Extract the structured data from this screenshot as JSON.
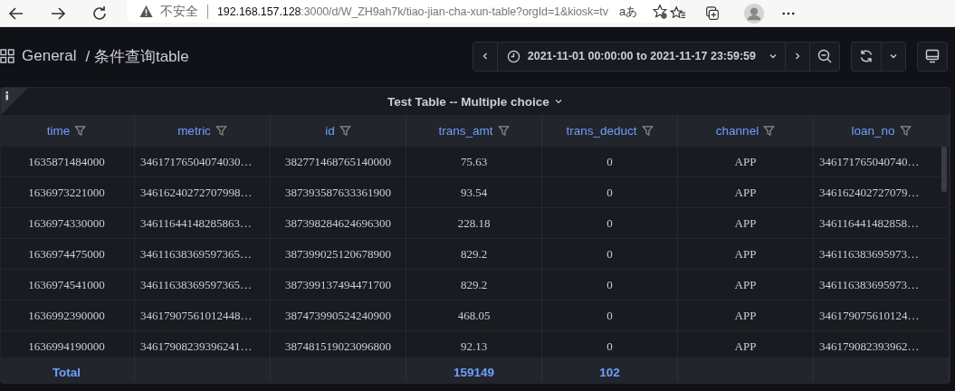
{
  "browser": {
    "security_label": "不安全",
    "url_host": "192.168.157.128",
    "url_rest": ":3000/d/W_ZH9ah7k/tiao-jian-cha-xun-table?orgId=1&kiosk=tv",
    "reader_label": "aあ"
  },
  "breadcrumb": {
    "folder": "General",
    "title": "/ 条件查询table"
  },
  "time_range": "2021-11-01 00:00:00 to 2021-11-17 23:59:59",
  "panel": {
    "title": "Test Table -- Multiple choice",
    "columns": [
      "time",
      "metric",
      "id",
      "trans_amt",
      "trans_deduct",
      "channel",
      "loan_no"
    ],
    "rows": [
      [
        "1635871484000",
        "34617176504074030…",
        "382771468765140000",
        "75.63",
        "0",
        "APP",
        "346171765040740…"
      ],
      [
        "1636973221000",
        "34616240272707998…",
        "387393587633361900",
        "93.54",
        "0",
        "APP",
        "346162402727079…"
      ],
      [
        "1636974330000",
        "34611644148285863…",
        "387398284624696300",
        "228.18",
        "0",
        "APP",
        "346116441482858…"
      ],
      [
        "1636974475000",
        "34611638369597365…",
        "387399025120678900",
        "829.2",
        "0",
        "APP",
        "346116383695973…"
      ],
      [
        "1636974541000",
        "34611638369597365…",
        "387399137494471700",
        "829.2",
        "0",
        "APP",
        "346116383695973…"
      ],
      [
        "1636992390000",
        "34617907561012448…",
        "387473990524240900",
        "468.05",
        "0",
        "APP",
        "346179075610124…"
      ],
      [
        "1636994190000",
        "34617908239396241…",
        "387481519023096800",
        "92.13",
        "0",
        "APP",
        "346179082393962…"
      ]
    ],
    "footer": [
      {
        "kind": "label",
        "text": "Total"
      },
      {
        "kind": "empty"
      },
      {
        "kind": "empty"
      },
      {
        "kind": "sum",
        "text": "159149"
      },
      {
        "kind": "sum",
        "text": "102"
      },
      {
        "kind": "empty"
      },
      {
        "kind": "empty"
      }
    ]
  }
}
